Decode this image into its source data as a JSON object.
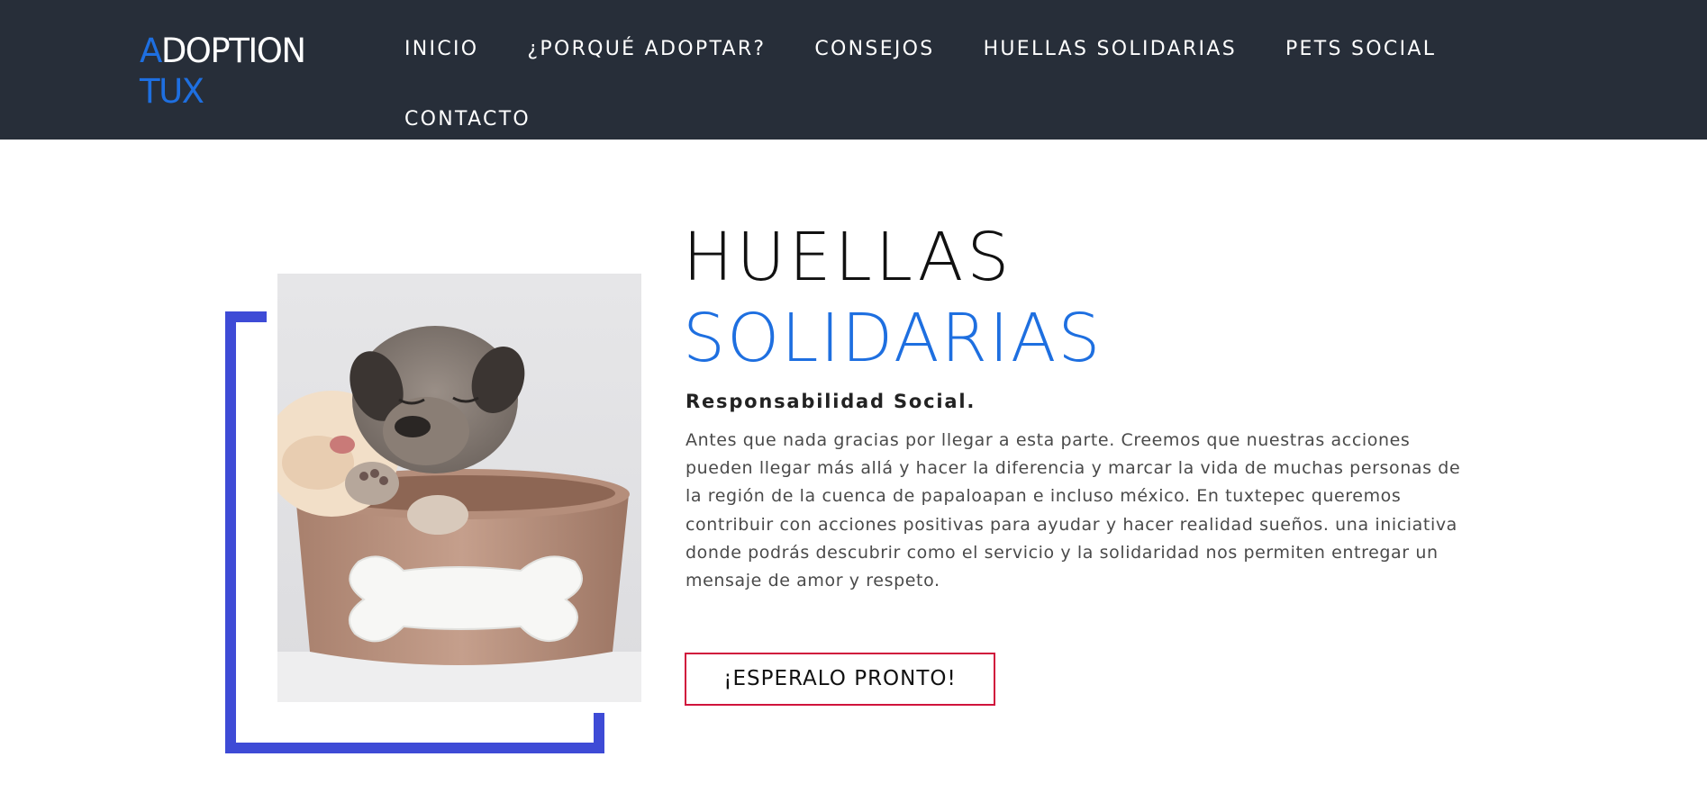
{
  "header": {
    "logo": {
      "first_letter": "A",
      "rest_line1": "DOPTION",
      "line2": "TUX"
    },
    "nav": [
      {
        "label": "INICIO"
      },
      {
        "label": "¿PORQUÉ ADOPTAR?"
      },
      {
        "label": "CONSEJOS"
      },
      {
        "label": "HUELLAS SOLIDARIAS"
      },
      {
        "label": "PETS SOCIAL"
      },
      {
        "label": "CONTACTO"
      }
    ]
  },
  "main": {
    "title_line1": "HUELLAS",
    "title_line2": "SOLIDARIAS",
    "subtitle": "Responsabilidad Social.",
    "body": "Antes que nada gracias por llegar a esta parte. Creemos que nuestras acciones pueden llegar más allá y hacer la diferencia y marcar la vida de muchas personas de la región de la cuenca de papaloapan e incluso méxico. En tuxtepec queremos contribuir con acciones positivas para ayudar y hacer realidad sueños. una iniciativa donde podrás descubrir como el servicio y la solidaridad nos permiten entregar un mensaje de amor y respeto.",
    "cta_label": "¡ESPERALO PRONTO!",
    "image_alt": "puppies-in-bowl-photo"
  },
  "colors": {
    "header_bg": "#272e39",
    "accent_blue": "#1e6fe0",
    "bracket_blue": "#3e4bd6",
    "cta_border": "#d0143c"
  }
}
